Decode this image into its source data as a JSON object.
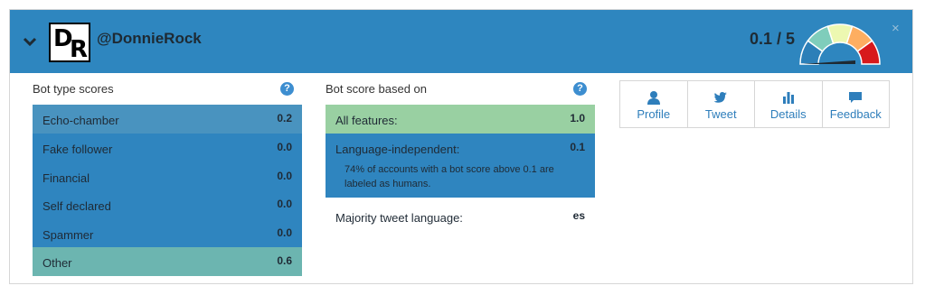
{
  "header": {
    "avatar_letters": [
      "D",
      "R"
    ],
    "handle": "@DonnieRock",
    "score": "0.1 / 5",
    "close_glyph": "×",
    "gauge_colors": [
      "#2c7fb8",
      "#7fcdbb",
      "#edf8b1",
      "#fdae61",
      "#d7191c"
    ]
  },
  "bot_type": {
    "title": "Bot type scores",
    "rows": [
      {
        "label": "Echo-chamber",
        "value": "0.2",
        "color": "#4993bf"
      },
      {
        "label": "Fake follower",
        "value": "0.0",
        "color": "#2f85bf"
      },
      {
        "label": "Financial",
        "value": "0.0",
        "color": "#2f85bf"
      },
      {
        "label": "Self declared",
        "value": "0.0",
        "color": "#2f85bf"
      },
      {
        "label": "Spammer",
        "value": "0.0",
        "color": "#2f85bf"
      },
      {
        "label": "Other",
        "value": "0.6",
        "color": "#6cb5b0"
      }
    ]
  },
  "bot_score": {
    "title": "Bot score based on",
    "all_features": {
      "label": "All features:",
      "value": "1.0",
      "color": "#99d0a2"
    },
    "language_independent": {
      "label": "Language-independent:",
      "value": "0.1",
      "note": "74% of accounts with a bot score above 0.1 are labeled as humans.",
      "color": "#2f85bf"
    },
    "majority_language": {
      "label": "Majority tweet language:",
      "value": "es"
    }
  },
  "actions": [
    {
      "label": "Profile",
      "icon": "user-icon"
    },
    {
      "label": "Tweet",
      "icon": "bird-icon"
    },
    {
      "label": "Details",
      "icon": "bar-chart-icon"
    },
    {
      "label": "Feedback",
      "icon": "comment-icon"
    }
  ]
}
